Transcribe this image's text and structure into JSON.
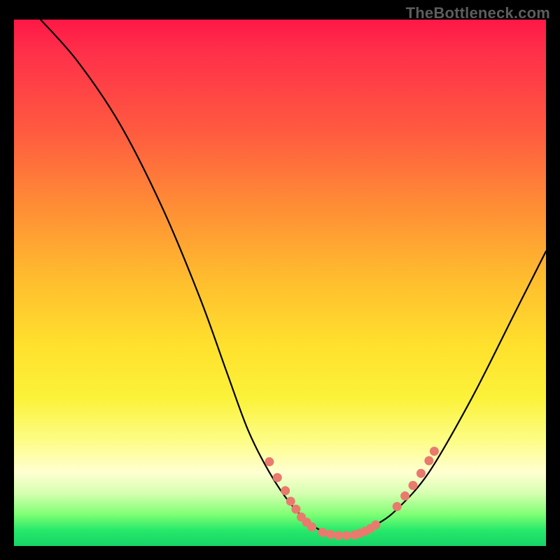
{
  "watermark": "TheBottleneck.com",
  "colors": {
    "background": "#000000",
    "watermark": "#5d5d5d",
    "curve": "#000000",
    "dot": "#e97a6d"
  },
  "chart_data": {
    "type": "line",
    "title": "",
    "xlabel": "",
    "ylabel": "",
    "xlim": [
      0,
      100
    ],
    "ylim": [
      0,
      100
    ],
    "series": [
      {
        "name": "bottleneck-curve",
        "x": [
          5,
          12,
          20,
          28,
          35,
          40,
          44,
          48,
          52,
          56,
          60,
          64,
          68,
          72,
          78,
          86,
          94,
          100
        ],
        "y": [
          100,
          92,
          80,
          64,
          47,
          33,
          22,
          14,
          8,
          4,
          2,
          2,
          4,
          7,
          14,
          28,
          44,
          56
        ]
      }
    ],
    "annotations": {
      "dot_clusters": [
        {
          "side": "left-arm",
          "points": [
            {
              "x": 48,
              "y": 16
            },
            {
              "x": 49.5,
              "y": 13
            },
            {
              "x": 51,
              "y": 10.5
            },
            {
              "x": 52,
              "y": 8.5
            },
            {
              "x": 53,
              "y": 7
            },
            {
              "x": 54,
              "y": 5.5
            },
            {
              "x": 55,
              "y": 4.5
            },
            {
              "x": 56,
              "y": 3.6
            }
          ]
        },
        {
          "side": "valley-floor",
          "points": [
            {
              "x": 58,
              "y": 2.6
            },
            {
              "x": 59.5,
              "y": 2.2
            },
            {
              "x": 61,
              "y": 2.0
            },
            {
              "x": 62.5,
              "y": 2.0
            },
            {
              "x": 64,
              "y": 2.1
            },
            {
              "x": 65,
              "y": 2.4
            },
            {
              "x": 66,
              "y": 2.8
            },
            {
              "x": 67,
              "y": 3.3
            },
            {
              "x": 68,
              "y": 4.0
            }
          ]
        },
        {
          "side": "right-arm",
          "points": [
            {
              "x": 72,
              "y": 7.5
            },
            {
              "x": 73.5,
              "y": 9.5
            },
            {
              "x": 75,
              "y": 11.5
            },
            {
              "x": 76.5,
              "y": 13.8
            },
            {
              "x": 78,
              "y": 16.2
            },
            {
              "x": 79,
              "y": 18
            }
          ]
        }
      ]
    }
  }
}
